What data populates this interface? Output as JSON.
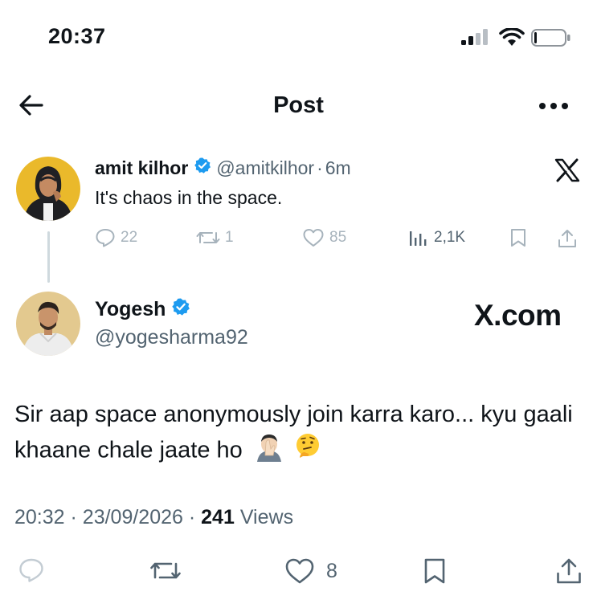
{
  "status_bar": {
    "time": "20:37"
  },
  "header": {
    "title": "Post"
  },
  "parent_tweet": {
    "name": "amit kilhor",
    "handle": "@amitkilhor",
    "separator": "·",
    "age": "6m",
    "text": "It's chaos in the space.",
    "replies": "22",
    "reposts": "1",
    "likes": "85",
    "views": "2,1K"
  },
  "reply_tweet": {
    "name": "Yogesh",
    "handle": "@yogesharma92",
    "watermark": "X.com",
    "text": "Sir aap space anonymously join karra karo... kyu gaali khaane chale jaate ho",
    "time": "20:32",
    "date": "23/09/2026",
    "views_count": "241",
    "views_label": "Views",
    "likes": "8"
  },
  "colors": {
    "verified": "#1d9bf0",
    "muted": "#536471",
    "text": "#0f1419",
    "divider": "#cfd9de"
  }
}
